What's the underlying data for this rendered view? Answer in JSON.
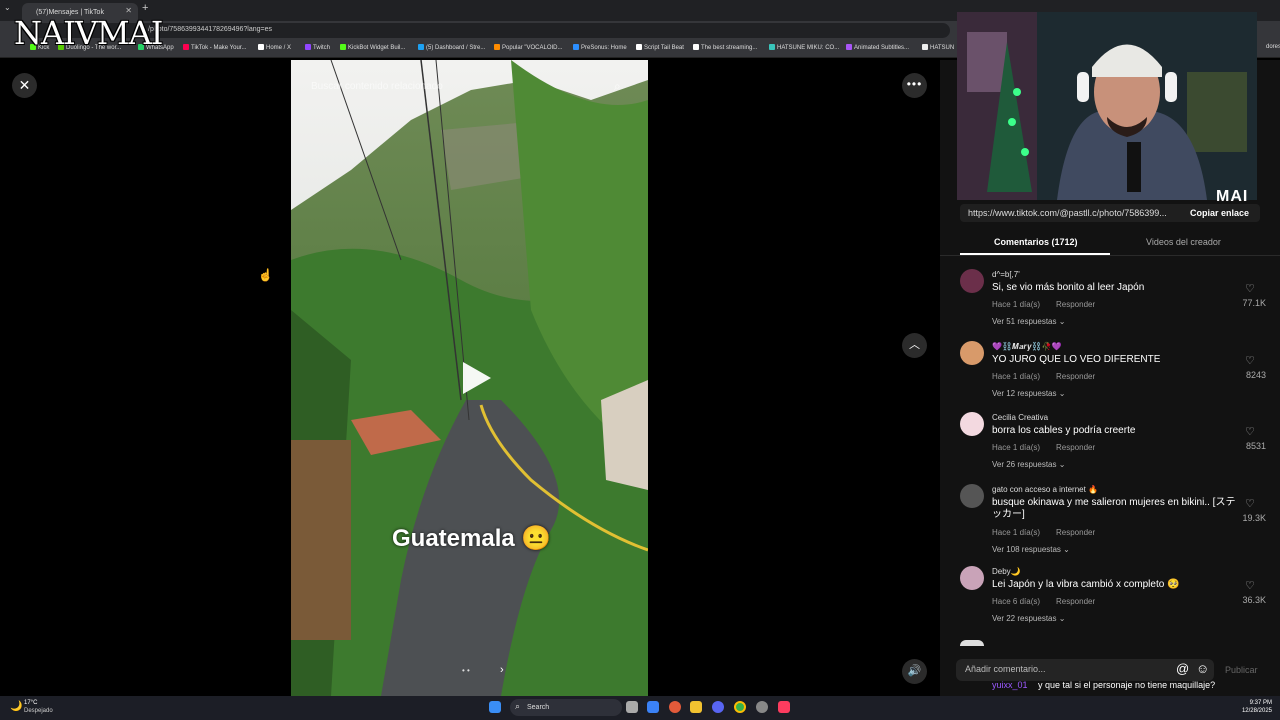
{
  "overlay": {
    "logo": "NAIVMAI",
    "cam_badge": "MAI"
  },
  "browser": {
    "tab_title": "(57)Mensajes | TikTok",
    "url": "/photo/7586399344178269496?lang=es",
    "bookmarks": [
      "Kick",
      "Duolingo - The wor...",
      "WhatsApp",
      "TikTok - Make Your...",
      "Home / X",
      "Twitch",
      "KickBot Widget Buil...",
      "(5) Dashboard / Stre...",
      "Popular \"VOCALOID...",
      "PreSonus: Home",
      "Script Tail Beat",
      "The best streaming...",
      "HATSUNE MIKU: CO...",
      "Animated Subtitles...",
      "HATSUN"
    ],
    "bookmark_tail": "dores"
  },
  "viewer": {
    "search_placeholder": "Buscar contenido relacionado",
    "caption": "Guatemala 😐"
  },
  "panel": {
    "link": "https://www.tiktok.com/@pastll.c/photo/7586399...",
    "copy_label": "Copiar enlace",
    "tab_comments": "Comentarios (1712)",
    "tab_videos": "Videos del creador",
    "comments": [
      {
        "user": "d^=b[,7'",
        "text": "Si, se vio más bonito al leer Japón",
        "time": "Hace 1 día(s)",
        "reply": "Responder",
        "more": "Ver 51 respuestas",
        "likes": "77.1K",
        "avatar_color": "#6b2f4a"
      },
      {
        "user": "💜⛓️𝑴𝒂𝒓𝒚⛓️🥀💜",
        "text": "YO JURO QUE LO VEO DIFERENTE",
        "time": "Hace 1 día(s)",
        "reply": "Responder",
        "more": "Ver 12 respuestas",
        "likes": "8243",
        "avatar_color": "#d89a6a"
      },
      {
        "user": "Cecilia Creativa",
        "text": "borra los cables y podría creerte",
        "time": "Hace 1 día(s)",
        "reply": "Responder",
        "more": "Ver 26 respuestas",
        "likes": "8531",
        "avatar_color": "#f3d9e0"
      },
      {
        "user": "gato con acceso a internet 🔥",
        "text": "busque okinawa y me salieron mujeres en bikini.. [ステッカー]",
        "time": "Hace 1 día(s)",
        "reply": "Responder",
        "more": "Ver 108 respuestas",
        "likes": "19.3K",
        "avatar_color": "#555555"
      },
      {
        "user": "Deby🌙",
        "text": "Lei Japón y la vibra cambió x completo 🥺",
        "time": "Hace 6 día(s)",
        "reply": "Responder",
        "more": "Ver 22 respuestas",
        "likes": "36.3K",
        "avatar_color": "#c9a3b8"
      }
    ],
    "comment_placeholder": "Añadir comentario...",
    "publish_label": "Publicar",
    "chat_user": "yuixx_01",
    "chat_text": "y que tal si el personaje no tiene maquillaje?"
  },
  "taskbar": {
    "temp": "17°C",
    "condition": "Despejado",
    "search_label": "Search",
    "time": "9:37 PM",
    "date": "12/28/2025"
  }
}
